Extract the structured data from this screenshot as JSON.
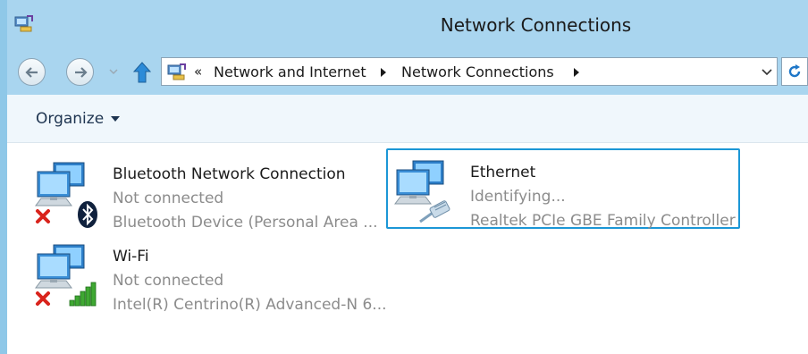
{
  "window": {
    "title": "Network Connections"
  },
  "address": {
    "overflow": "«",
    "crumbs": [
      "Network and Internet",
      "Network Connections"
    ]
  },
  "command_bar": {
    "organize_label": "Organize"
  },
  "connections": [
    {
      "name": "Bluetooth Network Connection",
      "status": "Not connected",
      "device": "Bluetooth Device (Personal Area ...",
      "adapter_icon": "bluetooth-icon",
      "disconnected": true
    },
    {
      "name": "Ethernet",
      "status": "Identifying...",
      "device": "Realtek PCIe GBE Family Controller",
      "adapter_icon": "ethernet-cable-icon",
      "disconnected": false,
      "selected": true
    },
    {
      "name": "Wi-Fi",
      "status": "Not connected",
      "device": "Intel(R) Centrino(R) Advanced-N 6...",
      "adapter_icon": "wifi-signal-icon",
      "disconnected": true
    }
  ],
  "colors": {
    "titlebar": "#a9d5ef",
    "selection_border": "#1c97d6",
    "disconnected_x": "#d9231c"
  }
}
